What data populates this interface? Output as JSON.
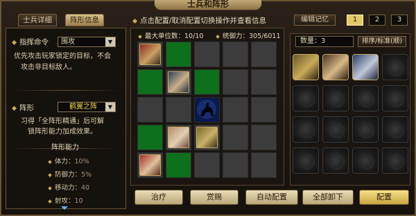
{
  "window": {
    "title": "士兵和阵形"
  },
  "tabs": [
    {
      "label": "士兵详细",
      "active": false
    },
    {
      "label": "阵形信息",
      "active": true
    }
  ],
  "hint": "点击配置/取消配置切换操作并查看信息",
  "memory": {
    "label": "编辑记忆",
    "slots": [
      "1",
      "2",
      "3"
    ],
    "active_index": 0
  },
  "left": {
    "command_label": "指挥命令",
    "command_value": "围攻",
    "command_desc_1": "优先攻击玩家锁定的目标，不会",
    "command_desc_2": "攻击非目标敌人。",
    "formation_label": "阵形",
    "formation_value": "鹤翼之阵",
    "formation_desc_1": "习得「全阵形精通」后可解",
    "formation_desc_2": "锁阵形能力加成效果。",
    "ability_title": "阵形能力",
    "stats": [
      {
        "label": "体力：",
        "value": "10%"
      },
      {
        "label": "防御力：",
        "value": "5%"
      },
      {
        "label": "移动力：",
        "value": "40"
      },
      {
        "label": "射攻：",
        "value": "10"
      }
    ]
  },
  "grid": {
    "max_units": "最大单位数：10/10",
    "command_power": "统御力：305/6011"
  },
  "roster": {
    "count": "数量：3",
    "sort_label": "排序/标准(顺)"
  },
  "buttons": {
    "heal": "治疗",
    "reward": "赏赐",
    "auto": "自动配置",
    "unload_all": "全部卸下",
    "deploy": "配置"
  },
  "colors": {
    "grid_green": "#0e6f1c",
    "grid_gray": "#3c3c3c",
    "accent_gold": "#e2c868"
  }
}
